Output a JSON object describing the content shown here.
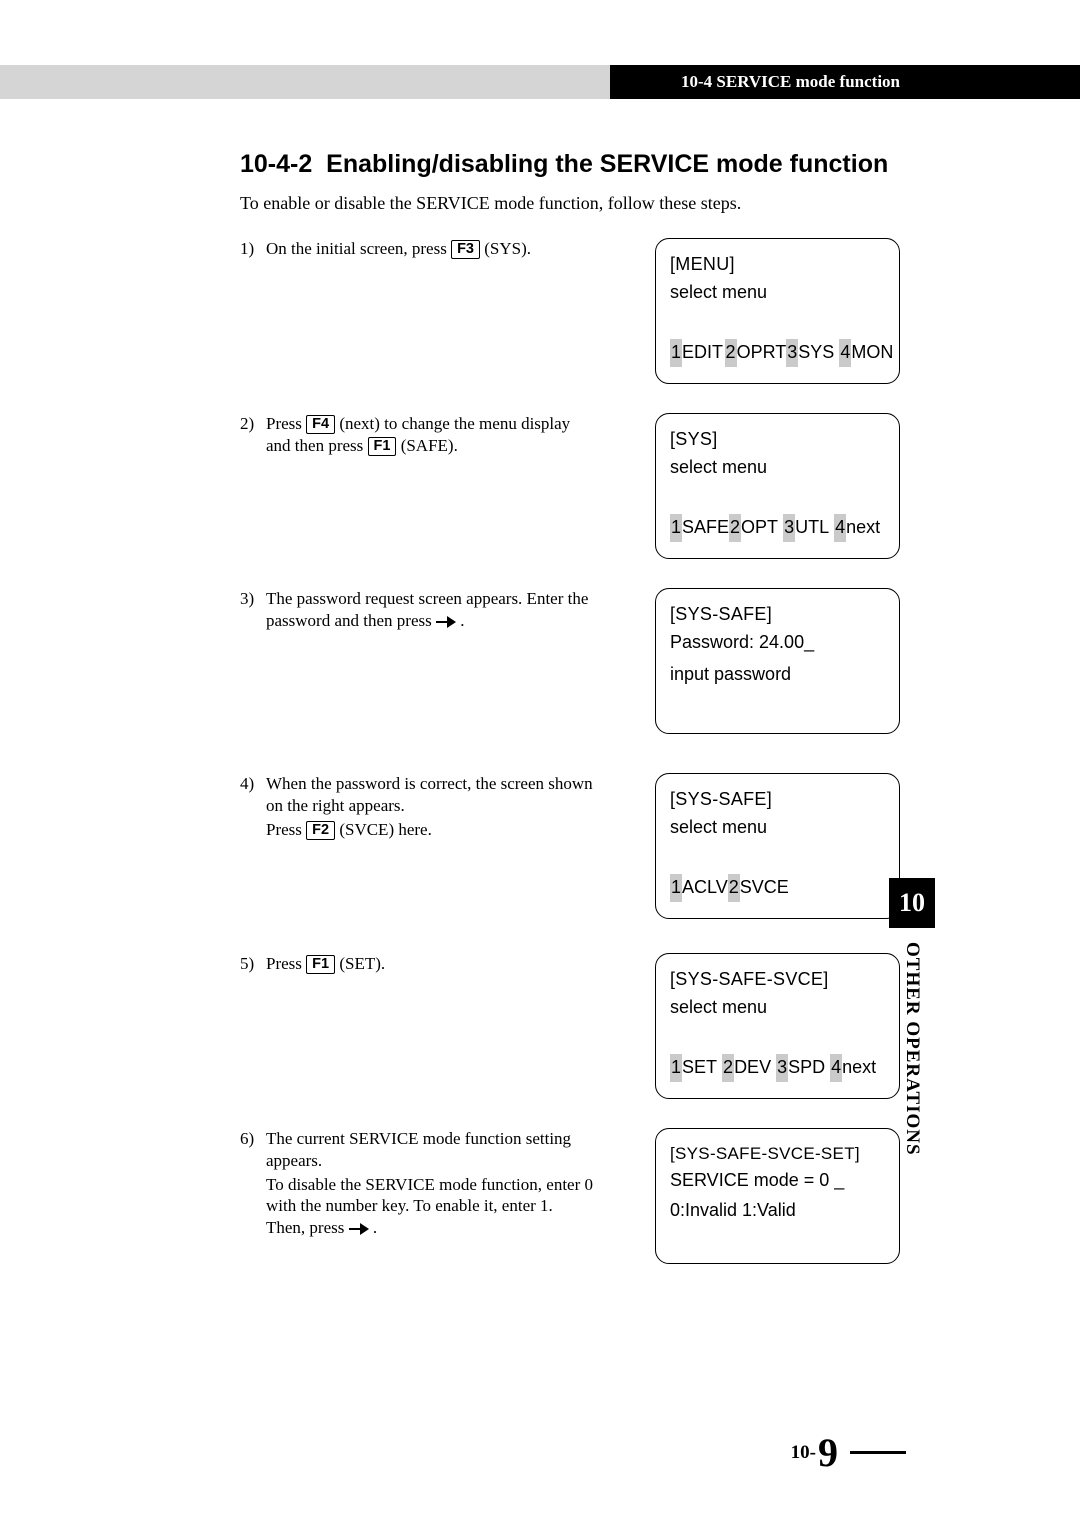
{
  "header": {
    "right": "10-4 SERVICE mode function"
  },
  "section": {
    "number": "10-4-2",
    "title": "Enabling/disabling the SERVICE mode function"
  },
  "intro": "To enable or disable the SERVICE mode function, follow these steps.",
  "steps": {
    "s1": {
      "num": "1)",
      "p1a": "On the initial screen, press ",
      "k1": "F3",
      "p1b": " (SYS)."
    },
    "s2": {
      "num": "2)",
      "p1a": "Press ",
      "k1": "F4",
      "p1b": " (next) to change the menu display and then press ",
      "k2": "F1",
      "p1c": " (SAFE)."
    },
    "s3": {
      "num": "3)",
      "p1a": "The password request screen appears. Enter the password and then press ",
      "p1b": " ."
    },
    "s4": {
      "num": "4)",
      "p1": "When the password is correct, the screen shown on the right appears.",
      "p2a": "Press ",
      "k1": "F2",
      "p2b": " (SVCE) here."
    },
    "s5": {
      "num": "5)",
      "p1a": "Press ",
      "k1": "F1",
      "p1b": " (SET)."
    },
    "s6": {
      "num": "6)",
      "p1": "The current SERVICE mode function setting appears.",
      "p2a": "To disable the SERVICE mode function, enter 0 with the number key. To enable it, enter 1. Then, press ",
      "p2b": " ."
    }
  },
  "screens": {
    "sc1": {
      "title": "[MENU]",
      "sub": "select menu",
      "m": {
        "n1": "1",
        "t1": "EDIT",
        "n2": "2",
        "t2": "OPRT",
        "n3": "3",
        "t3": "SYS",
        "n4": "4",
        "t4": "MON"
      }
    },
    "sc2": {
      "title": "[SYS]",
      "sub": "select menu",
      "m": {
        "n1": "1",
        "t1": "SAFE",
        "n2": "2",
        "t2": "OPT",
        "n3": "3",
        "t3": "UTL",
        "n4": "4",
        "t4": "next"
      }
    },
    "sc3": {
      "title": "[SYS-SAFE]",
      "l2": " Password: 24.00_",
      "l3": "input password"
    },
    "sc4": {
      "title": "[SYS-SAFE]",
      "sub": "select menu",
      "m": {
        "n1": "1",
        "t1": "ACLV",
        "n2": "2",
        "t2": "SVCE"
      }
    },
    "sc5": {
      "title": "[SYS-SAFE-SVCE]",
      "sub": "select menu",
      "m": {
        "n1": "1",
        "t1": "SET",
        "n2": "2",
        "t2": "DEV",
        "n3": "3",
        "t3": "SPD",
        "n4": "4",
        "t4": "next"
      }
    },
    "sc6": {
      "title": "[SYS-SAFE-SVCE-SET]",
      "l2": "SERVICE mode = 0 _",
      "l3": "0:Invalid 1:Valid"
    }
  },
  "thumb": {
    "num": "10",
    "text": "OTHER OPERATIONS"
  },
  "footer": {
    "prefix": "10-",
    "page": "9"
  }
}
